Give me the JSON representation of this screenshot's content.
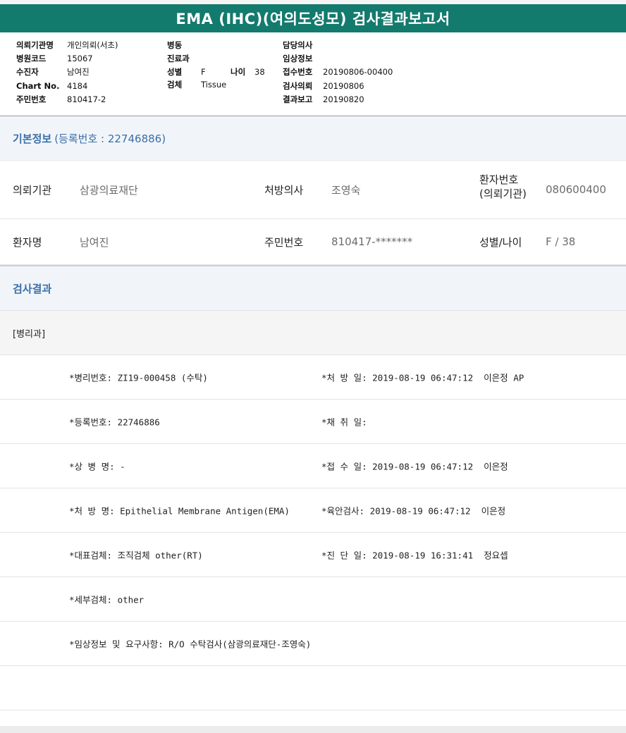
{
  "title": "EMA (IHC)(여의도성모) 검사결과보고서",
  "header": {
    "col1": [
      {
        "label": "의뢰기관명",
        "value": "개인의뢰(서초)"
      },
      {
        "label": "병원코드",
        "value": "15067"
      },
      {
        "label": "수진자",
        "value": "남여진"
      },
      {
        "label": "Chart No.",
        "value": "4184"
      },
      {
        "label": "주민번호",
        "value": "810417-2"
      }
    ],
    "col2": {
      "ward_label": "병동",
      "dept_label": "진료과",
      "sex_label": "성별",
      "sex_value": "F",
      "age_label": "나이",
      "age_value": "38",
      "specimen_label": "검체",
      "specimen_value": "Tissue"
    },
    "col3": [
      {
        "label": "담당의사",
        "value": ""
      },
      {
        "label": "임상정보",
        "value": ""
      },
      {
        "label": "접수번호",
        "value": "20190806-00400"
      },
      {
        "label": "검사의뢰",
        "value": "20190806"
      },
      {
        "label": "결과보고",
        "value": "20190820"
      }
    ]
  },
  "basic_info": {
    "heading": "기본정보",
    "reg_text": "(등록번호 : 22746886)",
    "rows": [
      {
        "a_label": "의뢰기관",
        "a_value": "삼광의료재단",
        "b_label": "처방의사",
        "b_value": "조영숙",
        "c_label_1": "환자번호",
        "c_label_2": "(의뢰기관)",
        "c_value": "080600400"
      },
      {
        "a_label": "환자명",
        "a_value": "남여진",
        "b_label": "주민번호",
        "b_value": "810417-*******",
        "c_label_1": "성별/나이",
        "c_value": "F / 38"
      }
    ]
  },
  "results": {
    "heading": "검사결과",
    "department": "[병리과]",
    "rows": [
      {
        "left": "*병리번호: ZI19-000458 (수탁)",
        "right": "*처 방 일: 2019-08-19 06:47:12  이은정 AP"
      },
      {
        "left": "*등록번호: 22746886",
        "right": "*채 취 일:"
      },
      {
        "left": "*상 병 명: -",
        "right": "*접 수 일: 2019-08-19 06:47:12  이은정"
      },
      {
        "left": "*처 방 명: Epithelial Membrane Antigen(EMA)",
        "right": "*육안검사: 2019-08-19 06:47:12  이은정"
      },
      {
        "left": "*대표검체: 조직검체 other(RT)",
        "right": "*진 단 일: 2019-08-19 16:31:41  정요셉"
      },
      {
        "left": "*세부검체: other",
        "right": ""
      },
      {
        "left": "*임상정보 및 요구사항: R/O 수탁검사(삼광의료재단-조영숙)",
        "right": ""
      },
      {
        "left": "",
        "right": ""
      }
    ]
  }
}
